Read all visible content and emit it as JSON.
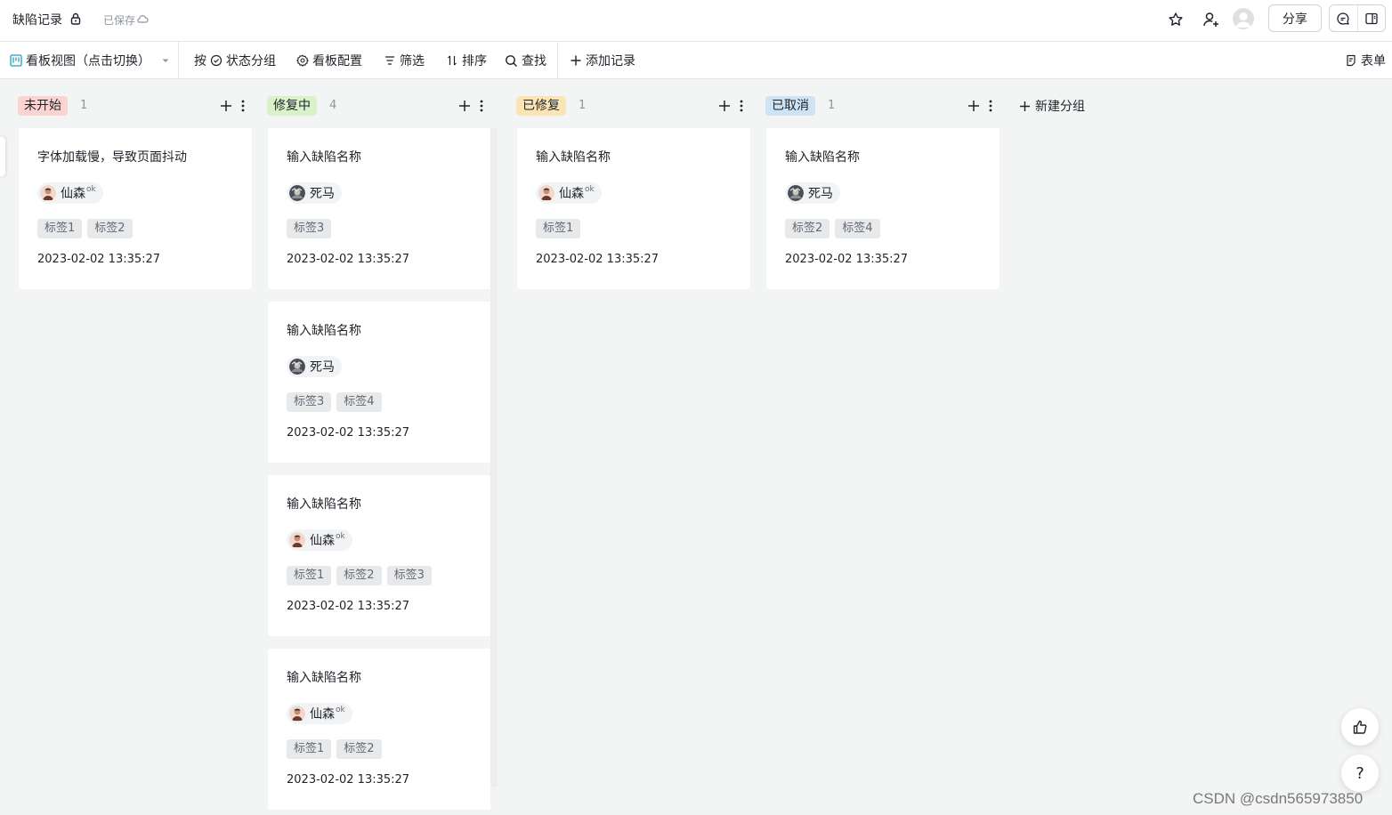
{
  "header": {
    "title": "缺陷记录",
    "saved_status": "已保存",
    "share_label": "分享"
  },
  "toolbar": {
    "view_label": "看板视图（点击切换）",
    "group_prefix": "按",
    "group_label": "状态分组",
    "config_label": "看板配置",
    "filter_label": "筛选",
    "sort_label": "排序",
    "search_label": "查找",
    "add_label": "添加记录",
    "form_label": "表单"
  },
  "board": {
    "new_group_label": "新建分组",
    "columns": [
      {
        "status": "未开始",
        "count": "1",
        "color": "#fbd4d2",
        "cards": [
          {
            "title": "字体加载慢，导致页面抖动",
            "user": "仙森",
            "user_suffix": "ok",
            "tags": [
              "标签1",
              "标签2"
            ],
            "date": "2023-02-02 13:35:27"
          }
        ]
      },
      {
        "status": "修复中",
        "count": "4",
        "color": "#d9f2c9",
        "cards": [
          {
            "title": "输入缺陷名称",
            "user": "死马",
            "user_suffix": "",
            "tags": [
              "标签3"
            ],
            "date": "2023-02-02 13:35:27"
          },
          {
            "title": "输入缺陷名称",
            "user": "死马",
            "user_suffix": "",
            "tags": [
              "标签3",
              "标签4"
            ],
            "date": "2023-02-02 13:35:27"
          },
          {
            "title": "输入缺陷名称",
            "user": "仙森",
            "user_suffix": "ok",
            "tags": [
              "标签1",
              "标签2",
              "标签3"
            ],
            "date": "2023-02-02 13:35:27"
          },
          {
            "title": "输入缺陷名称",
            "user": "仙森",
            "user_suffix": "ok",
            "tags": [
              "标签1",
              "标签2"
            ],
            "date": "2023-02-02 13:35:27"
          }
        ]
      },
      {
        "status": "已修复",
        "count": "1",
        "color": "#fbe5b6",
        "cards": [
          {
            "title": "输入缺陷名称",
            "user": "仙森",
            "user_suffix": "ok",
            "tags": [
              "标签1"
            ],
            "date": "2023-02-02 13:35:27"
          }
        ]
      },
      {
        "status": "已取消",
        "count": "1",
        "color": "#cde4f6",
        "cards": [
          {
            "title": "输入缺陷名称",
            "user": "死马",
            "user_suffix": "",
            "tags": [
              "标签2",
              "标签4"
            ],
            "date": "2023-02-02 13:35:27"
          }
        ]
      }
    ]
  },
  "help_label": "?",
  "watermark": "CSDN @csdn565973850"
}
